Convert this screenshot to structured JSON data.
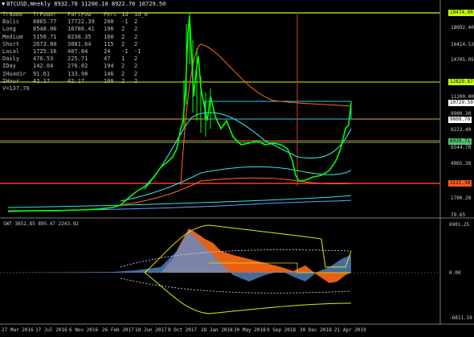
{
  "window": {
    "title": "BTCUSD,Weekly",
    "ohlc": "8932.70 11200.10 8922.70 10729.50"
  },
  "stats": {
    "header": [
      "TrName",
      "TrPower",
      "PartPow",
      "Perc",
      "1d",
      "1d_0"
    ],
    "rows": [
      [
        "Balic",
        "8865.77",
        "17722.39",
        "200",
        "-1",
        "2"
      ],
      [
        "Long",
        "8548.06",
        "16786.41",
        "196",
        "2",
        "2"
      ],
      [
        "Medium",
        "5156.71",
        "8238.35",
        "160",
        "2",
        "2"
      ],
      [
        "Short",
        "2673.80",
        "3081.64",
        "115",
        "2",
        "2"
      ],
      [
        "Local",
        "1725.16",
        "407.84",
        "24",
        "-1",
        "-1"
      ],
      [
        "Daily",
        "476.53",
        "225.71",
        "47",
        "1",
        "2"
      ],
      [
        "IDay",
        "142.04",
        "276.02",
        "194",
        "2",
        "2"
      ],
      [
        "IHuadir",
        "91.61",
        "133.98",
        "146",
        "2",
        "2"
      ],
      [
        "IHour",
        "42.17",
        "42.17",
        "100",
        "2",
        "2"
      ]
    ],
    "v_line": "V=137.70"
  },
  "price_axis": [
    "18092.40",
    "16414.53",
    "14705.95",
    "12829.87",
    "11200.00",
    "10729.50",
    "9900.30",
    "9009.70",
    "8222.40",
    "6929.71",
    "6544.70",
    "4965.30",
    "3121.30",
    "1700.20",
    "79.65"
  ],
  "price_boxes": [
    {
      "label": "19474.00",
      "bg": "#c8ff00",
      "fg": "#000000"
    },
    {
      "label": "12829.87",
      "bg": "#c8ff00",
      "fg": "#000000"
    },
    {
      "label": "10729.50",
      "bg": "#ffffff",
      "fg": "#000000"
    },
    {
      "label": "9009.70",
      "bg": "#ffffff",
      "fg": "#000000"
    },
    {
      "label": "6929.71",
      "bg": "#4cc36b",
      "fg": "#000000"
    },
    {
      "label": "3121.30",
      "bg": "#ff5a1f",
      "fg": "#000000"
    }
  ],
  "sub_window": {
    "title": "SWT 3852.85 895.47 2243.92",
    "axis": [
      "6901.25",
      "0.00",
      "-6811.59"
    ]
  },
  "time_axis": [
    "27 Mar 2016",
    "17 Jul 2016",
    "6 Nov 2016",
    "26 Feb 2017",
    "18 Jun 2017",
    "8 Oct 2017",
    "28 Jan 2018",
    "20 May 2018",
    "9 Sep 2018",
    "30 Dec 2018",
    "21 Apr 2019"
  ],
  "colors": {
    "bg": "#000000",
    "up": "#00ff00",
    "level_yellow": "#c8ff00",
    "orange": "#ff6a1a",
    "cyan": "#2ee6e6",
    "grid": "#7a7a7a"
  }
}
